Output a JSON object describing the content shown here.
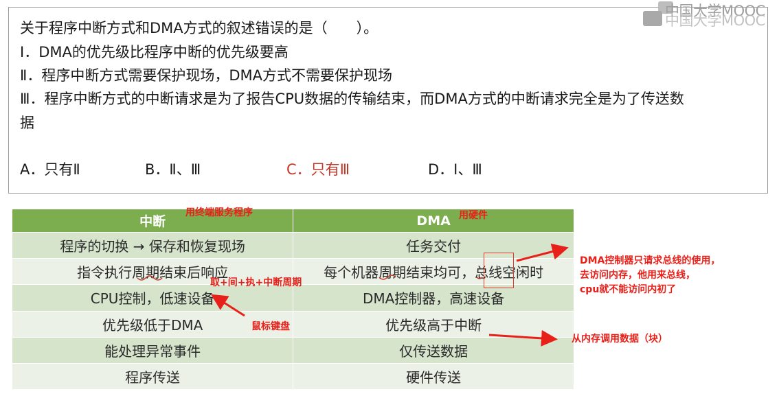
{
  "question": {
    "stem": "关于程序中断方式和DMA方式的叙述错误的是（　　）。",
    "statements": [
      "Ⅰ．DMA的优先级比程序中断的优先级要高",
      "Ⅱ．程序中断方式需要保护现场，DMA方式不需要保护现场",
      "Ⅲ．程序中断方式的中断请求是为了报告CPU数据的传输结束，而DMA方式的中断请求完全是为了传送数",
      "据"
    ],
    "options": [
      {
        "label": "A．只有Ⅱ",
        "correct": false
      },
      {
        "label": "B．Ⅱ、Ⅲ",
        "correct": false
      },
      {
        "label": "C．只有Ⅲ",
        "correct": true
      },
      {
        "label": "D．Ⅰ、Ⅲ",
        "correct": false
      }
    ]
  },
  "logo": {
    "text": "中国大学MOOC"
  },
  "table": {
    "headers": [
      "中断",
      "DMA"
    ],
    "rows": [
      [
        "程序的切换 → 保存和恢复现场",
        "任务交付"
      ],
      [
        "指令执行周期结束后响应",
        "每个机器周期结束均可，总线空闲时"
      ],
      [
        "CPU控制，低速设备",
        "DMA控制器，高速设备"
      ],
      [
        "优先级低于DMA",
        "优先级高于中断"
      ],
      [
        "能处理异常事件",
        "仅传送数据"
      ],
      [
        "程序传送",
        "硬件传送"
      ]
    ]
  },
  "annotations": {
    "interrupt_header_note": "用终端服务程序",
    "dma_header_note": "用硬件",
    "cycle_note": "取+间+执+中断周期",
    "device_note": "鼠标键盘",
    "bus_note": [
      "DMA控制器只请求总线的使用，",
      "去访问内存，他用来总线，",
      "cpu就不能访问内初了"
    ],
    "data_note": "从内存调用数据（块）"
  },
  "colors": {
    "table_header": "#7cad4e",
    "row_odd": "#d6e4cc",
    "row_even": "#ebf1e6",
    "annotation_red": "#e8201a",
    "correct_option": "#c0392b"
  }
}
